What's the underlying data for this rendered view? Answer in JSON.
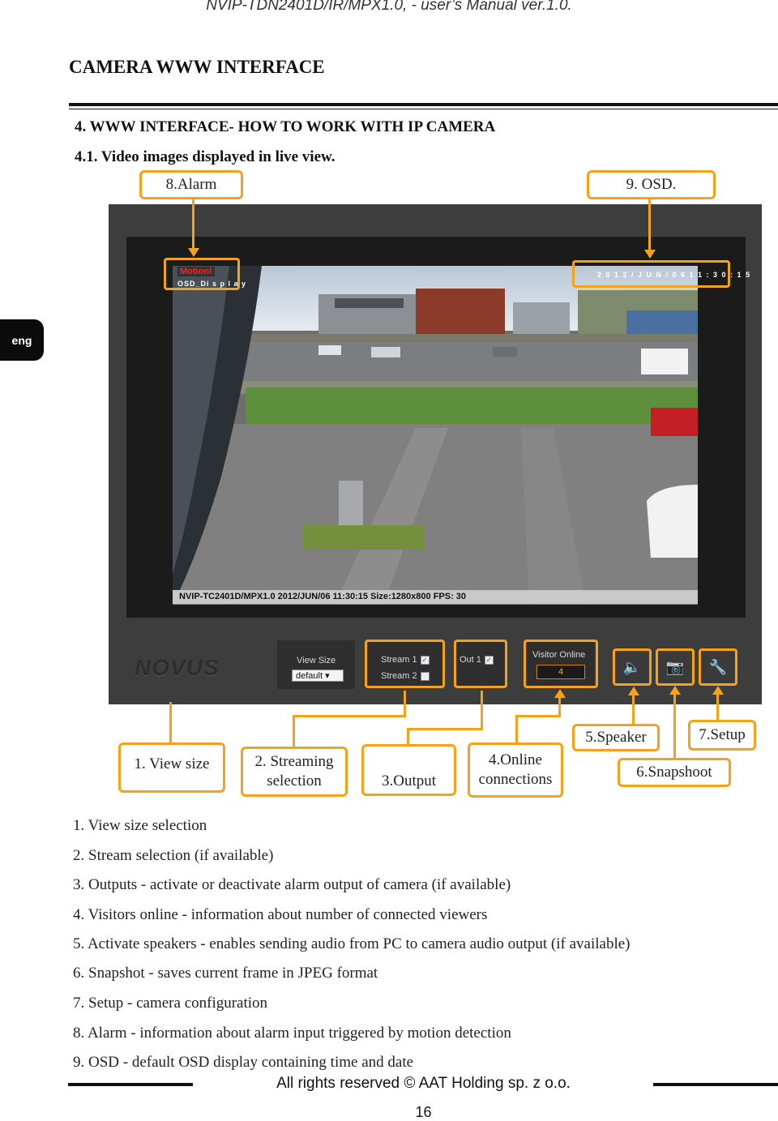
{
  "header": "NVIP-TDN2401D/IR/MPX1.0, - user’s Manual ver.1.0.",
  "section_title": "CAMERA WWW INTERFACE",
  "heading": "4. WWW INTERFACE- HOW TO WORK WITH IP CAMERA",
  "subheading": "4.1. Video images displayed in live view.",
  "lang_tab": "eng",
  "callouts": {
    "alarm": "8.Alarm",
    "osd": "9. OSD.",
    "view_size": "1. View size",
    "streaming_line1": "2. Streaming",
    "streaming_line2": "selection",
    "output": "3.Output",
    "online_line1": "4.Online",
    "online_line2": "connections",
    "speaker": "5.Speaker",
    "snapshot": "6.Snapshoot",
    "setup": "7.Setup"
  },
  "camera_ui": {
    "motion": "Motion!",
    "osd_display": "OSD_Di s p l a y",
    "datetime": "2 0 1 2 / J U N / 0 6   1 1 : 3 0 : 1 5",
    "osd_bar": "NVIP-TC2401D/MPX1.0 2012/JUN/06 11:30:15 Size:1280x800 FPS: 30",
    "logo": "NOVUS",
    "view_size_label": "View Size",
    "view_size_value": "default",
    "stream1": "Stream 1",
    "stream2": "Stream 2",
    "out1": "Out 1",
    "visitor_label": "Visitor Online",
    "visitor_count": "4"
  },
  "list": [
    "1. View size selection",
    "2. Stream selection (if available)",
    "3. Outputs - activate or deactivate alarm output of camera (if available)",
    "4. Visitors online - information about number of connected viewers",
    "5. Activate speakers - enables sending audio from PC to camera audio output (if available)",
    "6. Snapshot - saves current frame in JPEG format",
    "7. Setup - camera configuration",
    "8. Alarm - information about alarm input triggered by motion detection",
    "9. OSD - default OSD display containing time and date"
  ],
  "footer": "All rights reserved © AAT Holding sp. z o.o.",
  "page_number": "16",
  "colors": {
    "callout": "#f4a21a",
    "frame": "#3d3d3d"
  }
}
